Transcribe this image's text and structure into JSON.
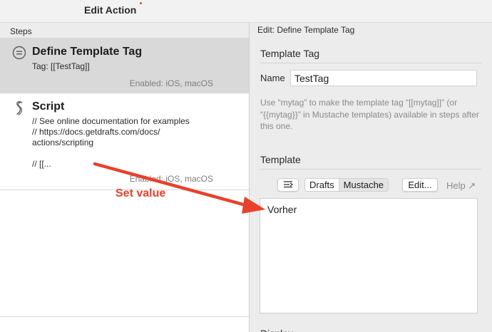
{
  "window": {
    "title": "Edit Action"
  },
  "steps_panel": {
    "header": "Steps",
    "steps": [
      {
        "title": "Define Template Tag",
        "subtitle": "Tag: [[TestTag]]",
        "enabled": "Enabled: iOS, macOS",
        "icon": "equals-circle-icon",
        "selected": true
      },
      {
        "title": "Script",
        "subtitle": "// See online documentation for examples\n// https://docs.getdrafts.com/docs/\nactions/scripting\n\n// [[...",
        "enabled": "Enabled: iOS, macOS",
        "icon": "script-icon",
        "selected": false
      }
    ]
  },
  "editor": {
    "header": "Edit: Define Template Tag",
    "template_tag": {
      "section_title": "Template Tag",
      "name_label": "Name",
      "name_value": "TestTag",
      "help": "Use “mytag” to make the template tag “[[mytag]]” (or “{{mytag}}” in Mustache templates) available in steps after this one."
    },
    "template": {
      "section_title": "Template",
      "toolbar": {
        "format_icon": "text-format-icon",
        "segments": [
          "Drafts",
          "Mustache"
        ],
        "selected_segment": "Drafts",
        "edit_label": "Edit...",
        "help_label": "Help ↗"
      },
      "content": "Vorher"
    },
    "cutoff_text": "Display"
  },
  "annotation": {
    "label": "Set value",
    "color": "#e8412a"
  }
}
